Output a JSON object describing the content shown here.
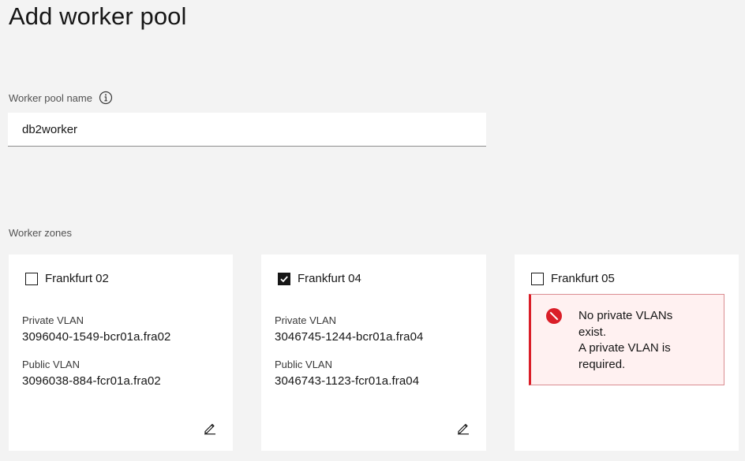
{
  "page": {
    "title": "Add worker pool"
  },
  "pool_name": {
    "label": "Worker pool name",
    "value": "db2worker",
    "info_icon": "info-icon"
  },
  "zones": {
    "label": "Worker zones",
    "items": [
      {
        "name": "Frankfurt 02",
        "checked": false,
        "private_vlan_label": "Private VLAN",
        "private_vlan": "3096040-1549-bcr01a.fra02",
        "public_vlan_label": "Public VLAN",
        "public_vlan": "3096038-884-fcr01a.fra02",
        "edit_icon": "pencil-icon"
      },
      {
        "name": "Frankfurt 04",
        "checked": true,
        "private_vlan_label": "Private VLAN",
        "private_vlan": "3046745-1244-bcr01a.fra04",
        "public_vlan_label": "Public VLAN",
        "public_vlan": "3046743-1123-fcr01a.fra04",
        "edit_icon": "pencil-icon"
      },
      {
        "name": "Frankfurt 05",
        "checked": false,
        "error": {
          "icon": "error-icon",
          "line1": "No private VLANs",
          "line2": "exist.",
          "line3": "A private VLAN is",
          "line4": "required."
        }
      }
    ]
  },
  "colors": {
    "background": "#f3f3f3",
    "card": "#ffffff",
    "error_accent": "#da1e28",
    "error_background": "#fff1f1"
  }
}
